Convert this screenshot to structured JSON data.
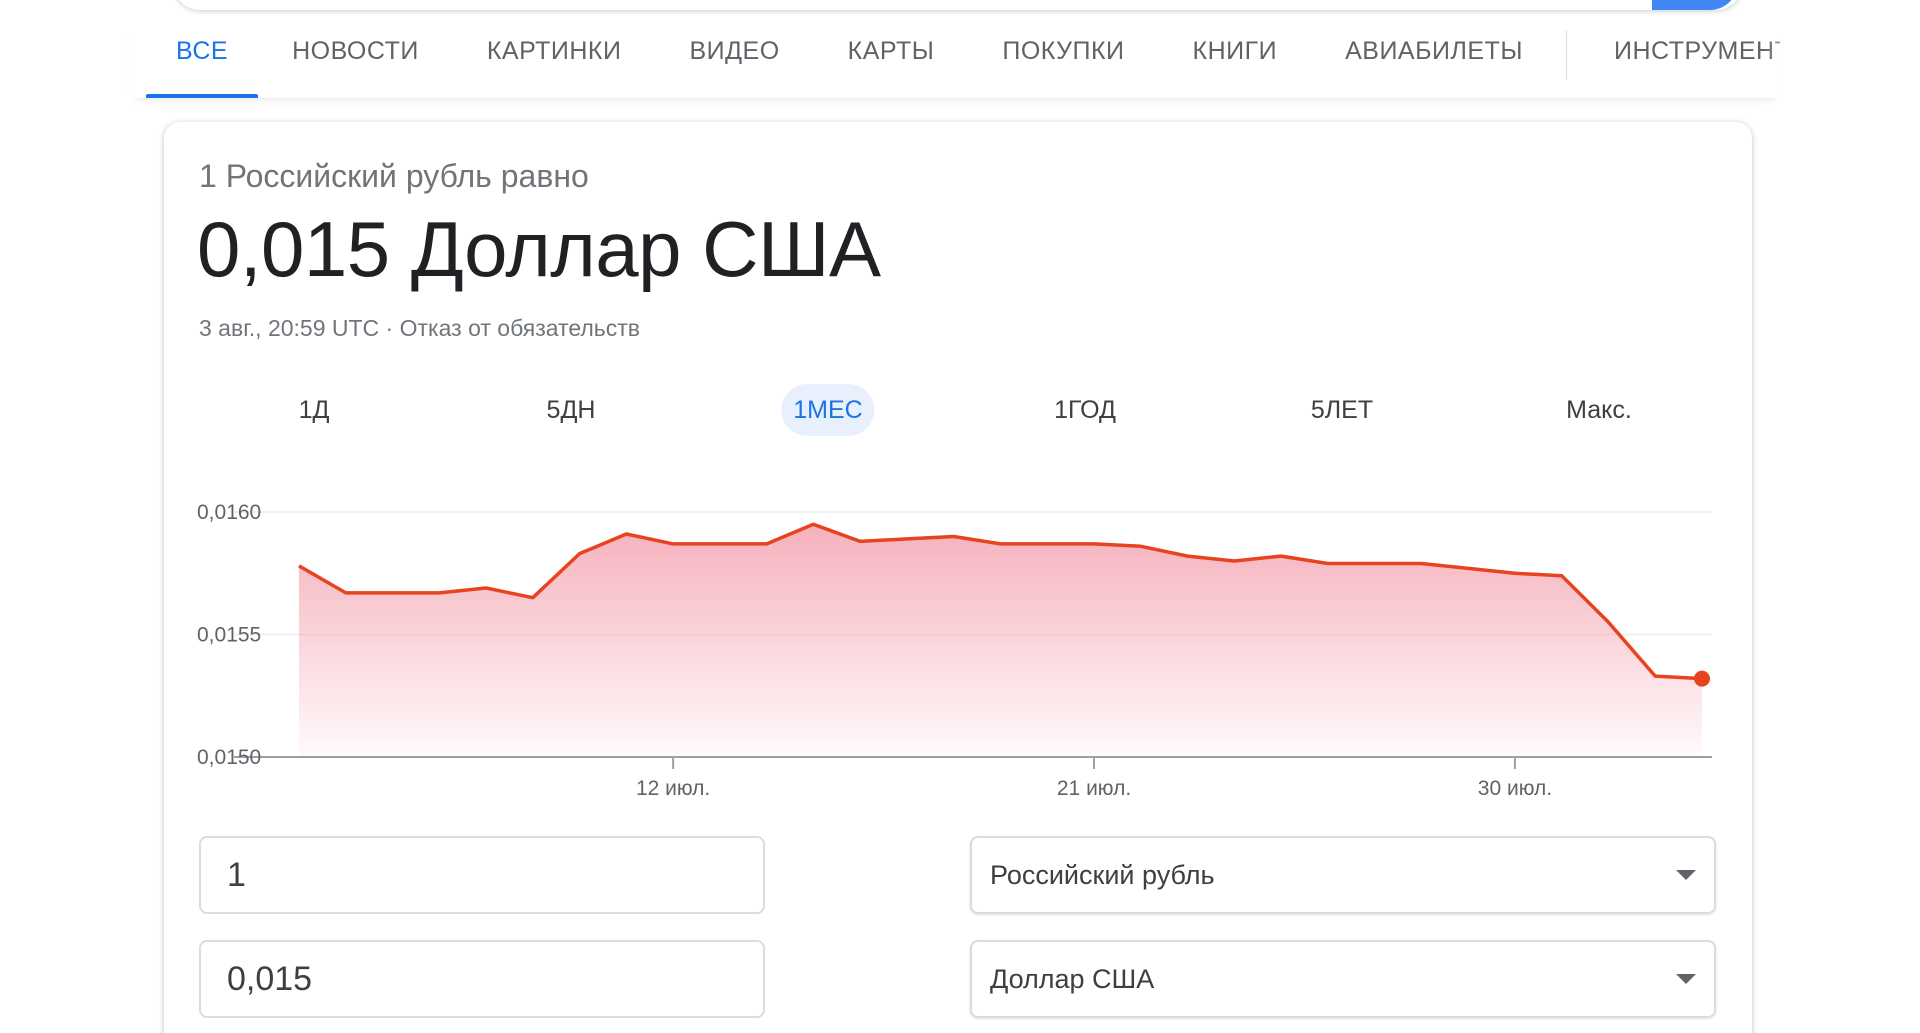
{
  "tabs": {
    "items": [
      {
        "label": "ВСЕ",
        "active": true
      },
      {
        "label": "НОВОСТИ",
        "active": false
      },
      {
        "label": "КАРТИНКИ",
        "active": false
      },
      {
        "label": "ВИДЕО",
        "active": false
      },
      {
        "label": "КАРТЫ",
        "active": false
      },
      {
        "label": "ПОКУПКИ",
        "active": false
      },
      {
        "label": "КНИГИ",
        "active": false
      },
      {
        "label": "АВИАБИЛЕТЫ",
        "active": false
      }
    ],
    "tools_label": "ИНСТРУМЕНТЫ",
    "active_color": "#1a73e8"
  },
  "converter": {
    "subtitle": "1 Российский рубль равно",
    "result": "0,015 Доллар США",
    "timestamp": "3 авг., 20:59 UTC",
    "separator": " · ",
    "disclaimer": "Отказ от обязательств",
    "from_amount": "1",
    "to_amount": "0,015",
    "from_currency": "Российский рубль",
    "to_currency": "Доллар США"
  },
  "ranges": [
    {
      "label": "1Д",
      "active": false
    },
    {
      "label": "5ДН",
      "active": false
    },
    {
      "label": "1МЕС",
      "active": true
    },
    {
      "label": "1ГОД",
      "active": false
    },
    {
      "label": "5ЛЕТ",
      "active": false
    },
    {
      "label": "Макс.",
      "active": false
    }
  ],
  "chart_data": {
    "type": "area",
    "x": [
      "4 июл.",
      "5 июл.",
      "6 июл.",
      "7 июл.",
      "8 июл.",
      "9 июл.",
      "10 июл.",
      "11 июл.",
      "12 июл.",
      "13 июл.",
      "14 июл.",
      "15 июл.",
      "16 июл.",
      "17 июл.",
      "18 июл.",
      "19 июл.",
      "20 июл.",
      "21 июл.",
      "22 июл.",
      "23 июл.",
      "24 июл.",
      "25 июл.",
      "26 июл.",
      "27 июл.",
      "28 июл.",
      "29 июл.",
      "30 июл.",
      "31 июл.",
      "1 авг.",
      "2 авг.",
      "3 авг."
    ],
    "values": [
      0.01578,
      0.01567,
      0.01567,
      0.01567,
      0.01569,
      0.01565,
      0.01583,
      0.01591,
      0.01587,
      0.01587,
      0.01587,
      0.01595,
      0.01588,
      0.01589,
      0.0159,
      0.01587,
      0.01587,
      0.01587,
      0.01586,
      0.01582,
      0.0158,
      0.01582,
      0.01579,
      0.01579,
      0.01579,
      0.01577,
      0.01575,
      0.01574,
      0.01555,
      0.01533,
      0.01532
    ],
    "ylim": [
      0.015,
      0.016
    ],
    "y_ticks": [
      0.015,
      0.0155,
      0.016
    ],
    "y_tick_labels": [
      "0,0150",
      "0,0155",
      "0,0160"
    ],
    "x_ticks": [
      "12 июл.",
      "21 июл.",
      "30 июл."
    ],
    "line_color": "#e8431f",
    "fill_color": "#f4a3b0",
    "grid": true
  }
}
